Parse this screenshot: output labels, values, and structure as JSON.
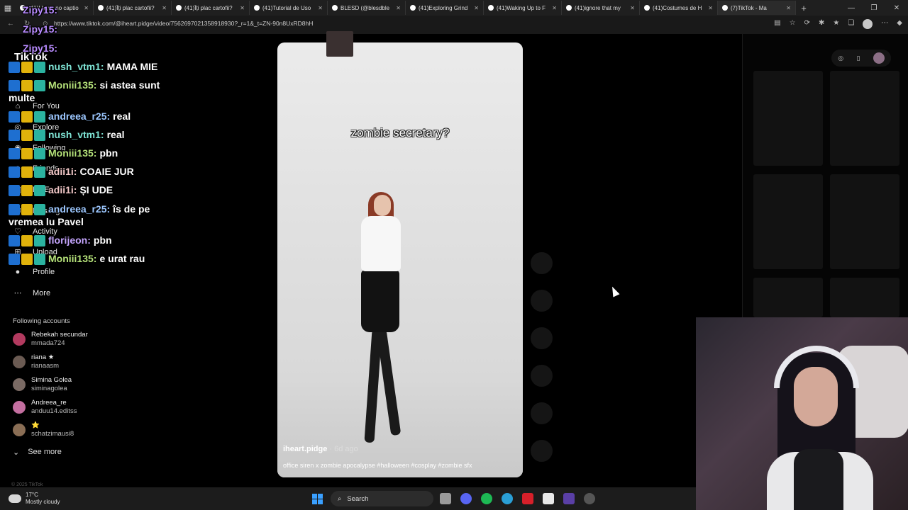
{
  "browser": {
    "tabs": [
      {
        "title": "(41)I have no captio",
        "active": false
      },
      {
        "title": "(41)Îți plac cartofii?",
        "active": false
      },
      {
        "title": "(41)Îți plac cartofii?",
        "active": false
      },
      {
        "title": "(41)Tutorial de Uso",
        "active": false
      },
      {
        "title": "BLESD (@blesdble",
        "active": false
      },
      {
        "title": "(41)Exploring Grind",
        "active": false
      },
      {
        "title": "(41)Waking Up to F",
        "active": false
      },
      {
        "title": "(41)ignore that my",
        "active": false
      },
      {
        "title": "(41)Costumes de H",
        "active": false
      },
      {
        "title": "(7)TikTok - Ma",
        "active": true
      }
    ],
    "new_tab": "+",
    "url": "https://www.tiktok.com/@iheart.pidge/video/7562697021358918930?_r=1&_t=ZN-90n8UxRD8hH"
  },
  "sidebar": {
    "logo": "TikTok",
    "nav": [
      {
        "label": "For You",
        "icon": "home-icon"
      },
      {
        "label": "Explore",
        "icon": "compass-icon"
      },
      {
        "label": "Following",
        "icon": "following-icon"
      },
      {
        "label": "Friends",
        "icon": "friends-icon"
      },
      {
        "label": "LIVE",
        "icon": "live-icon"
      },
      {
        "label": "Messages",
        "icon": "message-icon"
      },
      {
        "label": "Activity",
        "icon": "activity-icon"
      },
      {
        "label": "Upload",
        "icon": "upload-icon"
      },
      {
        "label": "Profile",
        "icon": "profile-avatar"
      },
      {
        "label": "More",
        "icon": "more-icon"
      }
    ],
    "following_title": "Following accounts",
    "accounts": [
      {
        "name": "Rebekah secundar",
        "handle": "mmada724",
        "color": "#b23a5f"
      },
      {
        "name": "riana ★",
        "handle": "rianaasm",
        "color": "#6b5b53"
      },
      {
        "name": "Simina Golea",
        "handle": "siminagolea",
        "color": "#7a6a64"
      },
      {
        "name": "Andreea_re",
        "handle": "anduu14.editss",
        "color": "#c46fa0"
      },
      {
        "name": "⭐",
        "handle": "schatzimausi8",
        "color": "#8a6e55"
      }
    ],
    "see_more": "See more",
    "copyright": "© 2025 TikTok"
  },
  "chat": {
    "header_lines": [
      "Zipy15:",
      "Zipy15:",
      "Zipy15:"
    ],
    "messages": [
      {
        "user": "nush_vtm1:",
        "text": "MAMA MIE",
        "color": "#7ee3d4"
      },
      {
        "user": "Moniii135:",
        "text": "si astea sunt",
        "color": "#b6e37a",
        "wrap": "multe"
      },
      {
        "user": "andreea_r25:",
        "text": "real",
        "color": "#9cc7ff"
      },
      {
        "user": "nush_vtm1:",
        "text": "real",
        "color": "#7ee3d4"
      },
      {
        "user": "Moniii135:",
        "text": "pbn",
        "color": "#b6e37a"
      },
      {
        "user": "adii1i:",
        "text": "COAIE JUR",
        "color": "#f2c8c8"
      },
      {
        "user": "adii1i:",
        "text": "ȘI UDE",
        "color": "#f2c8c8"
      },
      {
        "user": "andreea_r25:",
        "text": "îs de pe",
        "color": "#9cc7ff",
        "wrap": "vremea lu Pavel"
      },
      {
        "user": "florijeon:",
        "text": "pbn",
        "color": "#c6a6ff"
      },
      {
        "user": "Moniii135:",
        "text": "e urat rau",
        "color": "#b6e37a"
      }
    ]
  },
  "video": {
    "overlay_text": "zombie secretary?",
    "username": "iheart.pidge",
    "age": "· 6d ago",
    "description": "office siren x zombie apocalypse #halloween #cosplay #zombie sfx"
  },
  "taskbar": {
    "temperature": "17°C",
    "weather": "Mostly cloudy",
    "search_label": "Search"
  },
  "colors": {
    "accent": "#3aa0ff",
    "page_bg": "#000000"
  }
}
